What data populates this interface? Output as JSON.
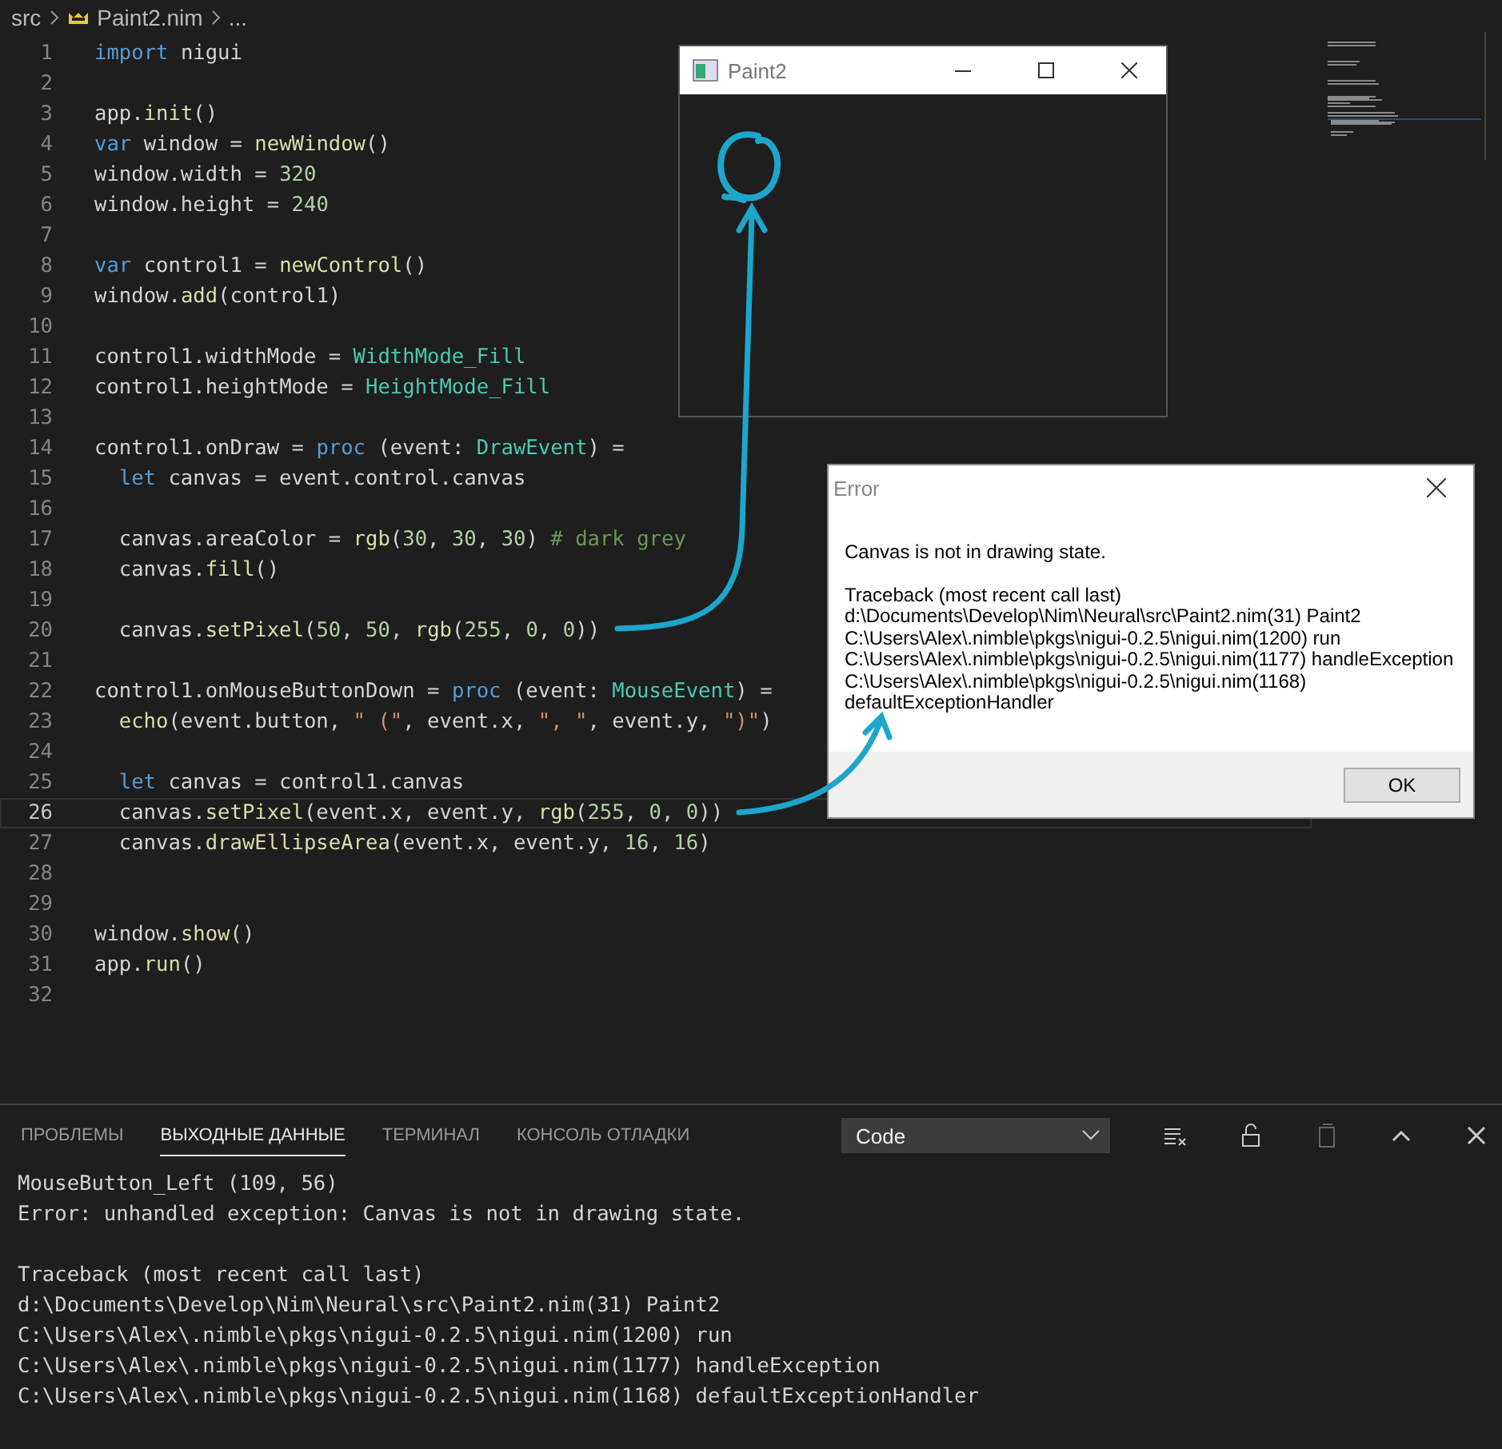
{
  "breadcrumb": {
    "folder": "src",
    "file": "Paint2.nim",
    "more": "..."
  },
  "code": [
    {
      "number": "1",
      "active": false,
      "tokens": [
        {
          "kind": "kw",
          "text": "import"
        },
        {
          "kind": "plain",
          "text": " nigui"
        }
      ]
    },
    {
      "number": "2",
      "active": false
    },
    {
      "number": "3",
      "active": false,
      "tokens": [
        {
          "kind": "plain",
          "text": "app."
        },
        {
          "kind": "fn",
          "text": "init"
        },
        {
          "kind": "plain",
          "text": "()"
        }
      ]
    },
    {
      "number": "4",
      "active": false,
      "tokens": [
        {
          "kind": "kw",
          "text": "var"
        },
        {
          "kind": "plain",
          "text": " window = "
        },
        {
          "kind": "fn",
          "text": "newWindow"
        },
        {
          "kind": "plain",
          "text": "()"
        }
      ]
    },
    {
      "number": "5",
      "active": false,
      "tokens": [
        {
          "kind": "plain",
          "text": "window.width = "
        },
        {
          "kind": "num",
          "text": "320"
        }
      ]
    },
    {
      "number": "6",
      "active": false,
      "tokens": [
        {
          "kind": "plain",
          "text": "window.height = "
        },
        {
          "kind": "num",
          "text": "240"
        }
      ]
    },
    {
      "number": "7",
      "active": false
    },
    {
      "number": "8",
      "active": false,
      "tokens": [
        {
          "kind": "kw",
          "text": "var"
        },
        {
          "kind": "plain",
          "text": " control1 = "
        },
        {
          "kind": "fn",
          "text": "newControl"
        },
        {
          "kind": "plain",
          "text": "()"
        }
      ]
    },
    {
      "number": "9",
      "active": false,
      "tokens": [
        {
          "kind": "plain",
          "text": "window."
        },
        {
          "kind": "fn",
          "text": "add"
        },
        {
          "kind": "plain",
          "text": "(control1)"
        }
      ]
    },
    {
      "number": "10",
      "active": false
    },
    {
      "number": "11",
      "active": false,
      "tokens": [
        {
          "kind": "plain",
          "text": "control1.widthMode = "
        },
        {
          "kind": "type",
          "text": "WidthMode_Fill"
        }
      ]
    },
    {
      "number": "12",
      "active": false,
      "tokens": [
        {
          "kind": "plain",
          "text": "control1.heightMode = "
        },
        {
          "kind": "type",
          "text": "HeightMode_Fill"
        }
      ]
    },
    {
      "number": "13",
      "active": false
    },
    {
      "number": "14",
      "active": false,
      "tokens": [
        {
          "kind": "plain",
          "text": "control1.onDraw = "
        },
        {
          "kind": "kw",
          "text": "proc"
        },
        {
          "kind": "plain",
          "text": " (event: "
        },
        {
          "kind": "type",
          "text": "DrawEvent"
        },
        {
          "kind": "plain",
          "text": ") ="
        }
      ]
    },
    {
      "number": "15",
      "active": false,
      "indented": true,
      "tokens": [
        {
          "kind": "kw",
          "text": "let"
        },
        {
          "kind": "plain",
          "text": " canvas = event.control.canvas"
        }
      ]
    },
    {
      "number": "16",
      "active": false
    },
    {
      "number": "17",
      "active": false,
      "indented": true,
      "tokens": [
        {
          "kind": "plain",
          "text": "canvas.areaColor = "
        },
        {
          "kind": "fn",
          "text": "rgb"
        },
        {
          "kind": "plain",
          "text": "("
        },
        {
          "kind": "num",
          "text": "30"
        },
        {
          "kind": "plain",
          "text": ", "
        },
        {
          "kind": "num",
          "text": "30"
        },
        {
          "kind": "plain",
          "text": ", "
        },
        {
          "kind": "num",
          "text": "30"
        },
        {
          "kind": "plain",
          "text": ") "
        },
        {
          "kind": "comment",
          "text": "# dark grey"
        }
      ]
    },
    {
      "number": "18",
      "active": false,
      "indented": true,
      "tokens": [
        {
          "kind": "plain",
          "text": "canvas."
        },
        {
          "kind": "fn",
          "text": "fill"
        },
        {
          "kind": "plain",
          "text": "()"
        }
      ]
    },
    {
      "number": "19",
      "active": false
    },
    {
      "number": "20",
      "active": false,
      "indented": true,
      "tokens": [
        {
          "kind": "plain",
          "text": "canvas."
        },
        {
          "kind": "fn",
          "text": "setPixel"
        },
        {
          "kind": "plain",
          "text": "("
        },
        {
          "kind": "num",
          "text": "50"
        },
        {
          "kind": "plain",
          "text": ", "
        },
        {
          "kind": "num",
          "text": "50"
        },
        {
          "kind": "plain",
          "text": ", "
        },
        {
          "kind": "fn",
          "text": "rgb"
        },
        {
          "kind": "plain",
          "text": "("
        },
        {
          "kind": "num",
          "text": "255"
        },
        {
          "kind": "plain",
          "text": ", "
        },
        {
          "kind": "num",
          "text": "0"
        },
        {
          "kind": "plain",
          "text": ", "
        },
        {
          "kind": "num",
          "text": "0"
        },
        {
          "kind": "plain",
          "text": "))"
        }
      ]
    },
    {
      "number": "21",
      "active": false
    },
    {
      "number": "22",
      "active": false,
      "tokens": [
        {
          "kind": "plain",
          "text": "control1.onMouseButtonDown = "
        },
        {
          "kind": "kw",
          "text": "proc"
        },
        {
          "kind": "plain",
          "text": " (event: "
        },
        {
          "kind": "type",
          "text": "MouseEvent"
        },
        {
          "kind": "plain",
          "text": ") ="
        }
      ]
    },
    {
      "number": "23",
      "active": false,
      "indented": true,
      "tokens": [
        {
          "kind": "fn",
          "text": "echo"
        },
        {
          "kind": "plain",
          "text": "(event.button, "
        },
        {
          "kind": "str",
          "text": "\" (\""
        },
        {
          "kind": "plain",
          "text": ", event.x, "
        },
        {
          "kind": "str",
          "text": "\", \""
        },
        {
          "kind": "plain",
          "text": ", event.y, "
        },
        {
          "kind": "str",
          "text": "\")\""
        },
        {
          "kind": "plain",
          "text": ")"
        }
      ]
    },
    {
      "number": "24",
      "active": false
    },
    {
      "number": "25",
      "active": false,
      "indented": true,
      "tokens": [
        {
          "kind": "kw",
          "text": "let"
        },
        {
          "kind": "plain",
          "text": " canvas = control1.canvas"
        }
      ]
    },
    {
      "number": "26",
      "active": true,
      "indented": true,
      "tokens": [
        {
          "kind": "plain",
          "text": "canvas."
        },
        {
          "kind": "fn",
          "text": "setPixel"
        },
        {
          "kind": "plain",
          "text": "(event.x, event.y, "
        },
        {
          "kind": "fn",
          "text": "rgb"
        },
        {
          "kind": "plain",
          "text": "("
        },
        {
          "kind": "num",
          "text": "255"
        },
        {
          "kind": "plain",
          "text": ", "
        },
        {
          "kind": "num",
          "text": "0"
        },
        {
          "kind": "plain",
          "text": ", "
        },
        {
          "kind": "num",
          "text": "0"
        },
        {
          "kind": "plain",
          "text": "))"
        }
      ]
    },
    {
      "number": "27",
      "active": false,
      "indented": true,
      "tokens": [
        {
          "kind": "plain",
          "text": "canvas."
        },
        {
          "kind": "fn",
          "text": "drawEllipseArea"
        },
        {
          "kind": "plain",
          "text": "(event.x, event.y, "
        },
        {
          "kind": "num",
          "text": "16"
        },
        {
          "kind": "plain",
          "text": ", "
        },
        {
          "kind": "num",
          "text": "16"
        },
        {
          "kind": "plain",
          "text": ")"
        }
      ]
    },
    {
      "number": "28",
      "active": false
    },
    {
      "number": "29",
      "active": false
    },
    {
      "number": "30",
      "active": false,
      "tokens": [
        {
          "kind": "plain",
          "text": "window."
        },
        {
          "kind": "fn",
          "text": "show"
        },
        {
          "kind": "plain",
          "text": "()"
        }
      ]
    },
    {
      "number": "31",
      "active": false,
      "tokens": [
        {
          "kind": "plain",
          "text": "app."
        },
        {
          "kind": "fn",
          "text": "run"
        },
        {
          "kind": "plain",
          "text": "()"
        }
      ]
    },
    {
      "number": "32",
      "active": false
    }
  ],
  "paint_window": {
    "title": "Paint2"
  },
  "error_dialog": {
    "title": "Error",
    "message": "Canvas is not in drawing state.",
    "traceback": [
      "Traceback (most recent call last)",
      "d:\\Documents\\Develop\\Nim\\Neural\\src\\Paint2.nim(31) Paint2",
      "C:\\Users\\Alex\\.nimble\\pkgs\\nigui-0.2.5\\nigui.nim(1200) run",
      "C:\\Users\\Alex\\.nimble\\pkgs\\nigui-0.2.5\\nigui.nim(1177) handleException",
      "C:\\Users\\Alex\\.nimble\\pkgs\\nigui-0.2.5\\nigui.nim(1168)",
      "defaultExceptionHandler"
    ],
    "button": "OK"
  },
  "panel": {
    "tabs": [
      {
        "label": "ПРОБЛЕМЫ",
        "selected": false
      },
      {
        "label": "ВЫХОДНЫЕ ДАННЫЕ",
        "selected": true
      },
      {
        "label": "ТЕРМИНАЛ",
        "selected": false
      },
      {
        "label": "КОНСОЛЬ ОТЛАДКИ",
        "selected": false
      }
    ],
    "channel": "Code",
    "output": [
      [
        "MouseButton_Left (109, 56)",
        "Error: unhandled exception: Canvas is not in drawing state."
      ],
      [
        "Traceback (most recent call last)",
        "d:\\Documents\\Develop\\Nim\\Neural\\src\\Paint2.nim(31) Paint2",
        "C:\\Users\\Alex\\.nimble\\pkgs\\nigui-0.2.5\\nigui.nim(1200) run",
        "C:\\Users\\Alex\\.nimble\\pkgs\\nigui-0.2.5\\nigui.nim(1177) handleException",
        "C:\\Users\\Alex\\.nimble\\pkgs\\nigui-0.2.5\\nigui.nim(1168) defaultExceptionHandler"
      ]
    ]
  }
}
